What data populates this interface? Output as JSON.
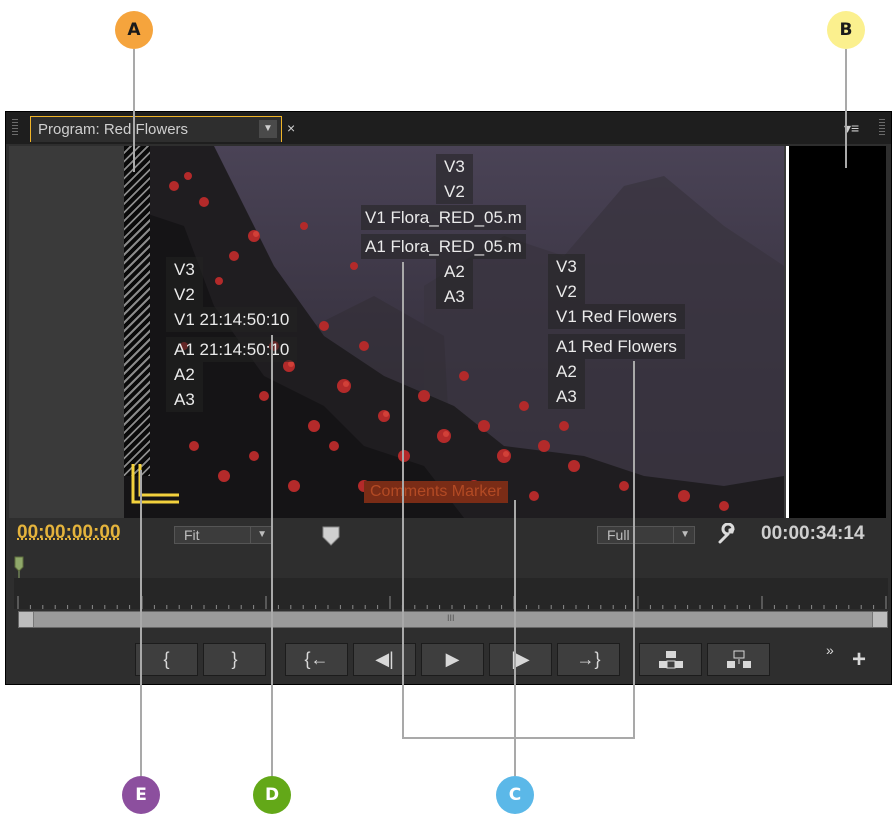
{
  "callouts": {
    "a": {
      "label": "A",
      "color": "#f5a43d"
    },
    "b": {
      "label": "B",
      "color": "#fbf08e"
    },
    "c": {
      "label": "C",
      "color": "#5bb8e8"
    },
    "d": {
      "label": "D",
      "color": "#63a818"
    },
    "e": {
      "label": "E",
      "color": "#8c4f9e"
    }
  },
  "panel": {
    "tab_title": "Program: Red Flowers",
    "tab_menu_glyph": "▼",
    "tab_close_glyph": "×",
    "panel_menu_glyph": "▾≡"
  },
  "overlay": {
    "center_tracks": [
      "V3",
      "V2",
      "V1 Flora_RED_05.m",
      "A1 Flora_RED_05.m",
      "A2",
      "A3"
    ],
    "left_tracks": [
      "V3",
      "V2",
      "V1 21:14:50:10",
      "A1 21:14:50:10",
      "A2",
      "A3"
    ],
    "right_tracks": [
      "V3",
      "V2",
      "V1 Red Flowers",
      "A1 Red Flowers",
      "A2",
      "A3"
    ],
    "marker_text": "Comments Marker"
  },
  "controls": {
    "timecode_current": "00:00:00:00",
    "zoom_select": "Fit",
    "resolution_select": "Full",
    "timecode_duration": "00:00:34:14",
    "accent": "#e4b33c",
    "scroll_center_glyph": "III",
    "more_glyph": "»",
    "add_glyph": "+"
  },
  "buttons": [
    {
      "name": "mark-in",
      "glyph": "{"
    },
    {
      "name": "mark-out",
      "glyph": "}"
    },
    {
      "name": "go-to-in",
      "glyph": "{←"
    },
    {
      "name": "step-back",
      "glyph": "◀|"
    },
    {
      "name": "play",
      "glyph": "▶"
    },
    {
      "name": "step-forward",
      "glyph": "|▶"
    },
    {
      "name": "go-to-out",
      "glyph": "→}"
    },
    {
      "name": "lift",
      "glyph": ""
    },
    {
      "name": "extract",
      "glyph": ""
    }
  ]
}
